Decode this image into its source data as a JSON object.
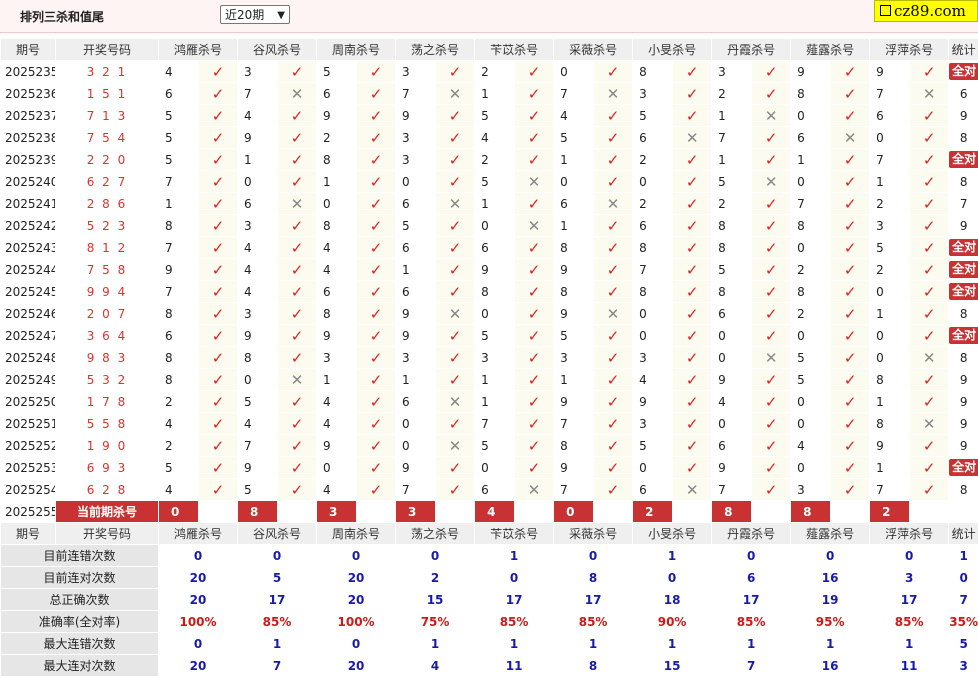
{
  "header": {
    "title": "排列三杀和值尾",
    "period_select": "近20期",
    "logo_text": "cz89.com"
  },
  "columns": {
    "period": "期号",
    "draw": "开奖号码",
    "experts": [
      "鸿雁杀号",
      "谷风杀号",
      "周南杀号",
      "荡之杀号",
      "苄苡杀号",
      "采薇杀号",
      "小旻杀号",
      "丹霞杀号",
      "薤露杀号",
      "浮萍杀号"
    ],
    "stat": "统计"
  },
  "rows": [
    {
      "period": "2025235",
      "draw": "321",
      "k": [
        4,
        3,
        5,
        3,
        2,
        0,
        8,
        3,
        9,
        9
      ],
      "r": [
        1,
        1,
        1,
        1,
        1,
        1,
        1,
        1,
        1,
        1
      ],
      "stat": "全对"
    },
    {
      "period": "2025236",
      "draw": "151",
      "k": [
        6,
        7,
        6,
        7,
        1,
        7,
        3,
        2,
        8,
        7
      ],
      "r": [
        1,
        0,
        1,
        0,
        1,
        0,
        1,
        1,
        1,
        0
      ],
      "stat": "6"
    },
    {
      "period": "2025237",
      "draw": "713",
      "k": [
        5,
        4,
        9,
        9,
        5,
        4,
        5,
        1,
        0,
        6
      ],
      "r": [
        1,
        1,
        1,
        1,
        1,
        1,
        1,
        0,
        1,
        1
      ],
      "stat": "9"
    },
    {
      "period": "2025238",
      "draw": "754",
      "k": [
        5,
        9,
        2,
        3,
        4,
        5,
        6,
        7,
        6,
        0
      ],
      "r": [
        1,
        1,
        1,
        1,
        1,
        1,
        0,
        1,
        0,
        1
      ],
      "stat": "8"
    },
    {
      "period": "2025239",
      "draw": "220",
      "k": [
        5,
        1,
        8,
        3,
        2,
        1,
        2,
        1,
        1,
        7
      ],
      "r": [
        1,
        1,
        1,
        1,
        1,
        1,
        1,
        1,
        1,
        1
      ],
      "stat": "全对"
    },
    {
      "period": "2025240",
      "draw": "627",
      "k": [
        7,
        0,
        1,
        0,
        5,
        0,
        0,
        5,
        0,
        1
      ],
      "r": [
        1,
        1,
        1,
        1,
        0,
        1,
        1,
        0,
        1,
        1
      ],
      "stat": "8"
    },
    {
      "period": "2025241",
      "draw": "286",
      "k": [
        1,
        6,
        0,
        6,
        1,
        6,
        2,
        2,
        7,
        2
      ],
      "r": [
        1,
        0,
        1,
        0,
        1,
        0,
        1,
        1,
        1,
        1
      ],
      "stat": "7"
    },
    {
      "period": "2025242",
      "draw": "523",
      "k": [
        8,
        3,
        8,
        5,
        0,
        1,
        6,
        8,
        8,
        3
      ],
      "r": [
        1,
        1,
        1,
        1,
        0,
        1,
        1,
        1,
        1,
        1
      ],
      "stat": "9"
    },
    {
      "period": "2025243",
      "draw": "812",
      "k": [
        7,
        4,
        4,
        6,
        6,
        8,
        8,
        8,
        0,
        5
      ],
      "r": [
        1,
        1,
        1,
        1,
        1,
        1,
        1,
        1,
        1,
        1
      ],
      "stat": "全对"
    },
    {
      "period": "2025244",
      "draw": "758",
      "k": [
        9,
        4,
        4,
        1,
        9,
        9,
        7,
        5,
        2,
        2
      ],
      "r": [
        1,
        1,
        1,
        1,
        1,
        1,
        1,
        1,
        1,
        1
      ],
      "stat": "全对"
    },
    {
      "period": "2025245",
      "draw": "994",
      "k": [
        7,
        4,
        6,
        6,
        8,
        8,
        8,
        8,
        8,
        0
      ],
      "r": [
        1,
        1,
        1,
        1,
        1,
        1,
        1,
        1,
        1,
        1
      ],
      "stat": "全对"
    },
    {
      "period": "2025246",
      "draw": "207",
      "k": [
        8,
        3,
        8,
        9,
        0,
        9,
        0,
        6,
        2,
        1
      ],
      "r": [
        1,
        1,
        1,
        0,
        1,
        0,
        1,
        1,
        1,
        1
      ],
      "stat": "8"
    },
    {
      "period": "2025247",
      "draw": "364",
      "k": [
        6,
        9,
        9,
        9,
        5,
        5,
        0,
        0,
        0,
        0
      ],
      "r": [
        1,
        1,
        1,
        1,
        1,
        1,
        1,
        1,
        1,
        1
      ],
      "stat": "全对"
    },
    {
      "period": "2025248",
      "draw": "983",
      "k": [
        8,
        8,
        3,
        3,
        3,
        3,
        3,
        0,
        5,
        0
      ],
      "r": [
        1,
        1,
        1,
        1,
        1,
        1,
        1,
        0,
        1,
        0
      ],
      "stat": "8"
    },
    {
      "period": "2025249",
      "draw": "532",
      "k": [
        8,
        0,
        1,
        1,
        1,
        1,
        4,
        9,
        5,
        8
      ],
      "r": [
        1,
        0,
        1,
        1,
        1,
        1,
        1,
        1,
        1,
        1
      ],
      "stat": "9"
    },
    {
      "period": "2025250",
      "draw": "178",
      "k": [
        2,
        5,
        4,
        6,
        1,
        9,
        9,
        4,
        0,
        1
      ],
      "r": [
        1,
        1,
        1,
        0,
        1,
        1,
        1,
        1,
        1,
        1
      ],
      "stat": "9"
    },
    {
      "period": "2025251",
      "draw": "558",
      "k": [
        4,
        4,
        4,
        0,
        7,
        7,
        3,
        0,
        0,
        8
      ],
      "r": [
        1,
        1,
        1,
        1,
        1,
        1,
        1,
        1,
        1,
        0
      ],
      "stat": "9"
    },
    {
      "period": "2025252",
      "draw": "190",
      "k": [
        2,
        7,
        9,
        0,
        5,
        8,
        5,
        6,
        4,
        9
      ],
      "r": [
        1,
        1,
        1,
        0,
        1,
        1,
        1,
        1,
        1,
        1
      ],
      "stat": "9"
    },
    {
      "period": "2025253",
      "draw": "693",
      "k": [
        5,
        9,
        0,
        9,
        0,
        9,
        0,
        9,
        0,
        1
      ],
      "r": [
        1,
        1,
        1,
        1,
        1,
        1,
        1,
        1,
        1,
        1
      ],
      "stat": "全对"
    },
    {
      "period": "2025254",
      "draw": "628",
      "k": [
        4,
        5,
        4,
        7,
        6,
        7,
        6,
        7,
        3,
        7
      ],
      "r": [
        1,
        1,
        1,
        1,
        0,
        1,
        0,
        1,
        1,
        1
      ],
      "stat": "8"
    }
  ],
  "current": {
    "period": "2025255",
    "label": "当前期杀号",
    "kills": [
      "0",
      "8",
      "3",
      "3",
      "4",
      "0",
      "2",
      "8",
      "8",
      "2"
    ]
  },
  "summary": {
    "header_period": "期号",
    "header_draw": "开奖号码",
    "rows": [
      {
        "label": "目前连错次数",
        "values": [
          "0",
          "0",
          "0",
          "0",
          "1",
          "0",
          "1",
          "0",
          "0",
          "0"
        ],
        "stat": "1",
        "pct": false
      },
      {
        "label": "目前连对次数",
        "values": [
          "20",
          "5",
          "20",
          "2",
          "0",
          "8",
          "0",
          "6",
          "16",
          "3"
        ],
        "stat": "0",
        "pct": false
      },
      {
        "label": "总正确次数",
        "values": [
          "20",
          "17",
          "20",
          "15",
          "17",
          "17",
          "18",
          "17",
          "19",
          "17"
        ],
        "stat": "7",
        "pct": false
      },
      {
        "label": "准确率(全对率)",
        "values": [
          "100%",
          "85%",
          "100%",
          "75%",
          "85%",
          "85%",
          "90%",
          "85%",
          "95%",
          "85%"
        ],
        "stat": "35%",
        "pct": true
      },
      {
        "label": "最大连错次数",
        "values": [
          "0",
          "1",
          "0",
          "1",
          "1",
          "1",
          "1",
          "1",
          "1",
          "1"
        ],
        "stat": "5",
        "pct": false
      },
      {
        "label": "最大连对次数",
        "values": [
          "20",
          "7",
          "20",
          "4",
          "11",
          "8",
          "15",
          "7",
          "16",
          "11"
        ],
        "stat": "3",
        "pct": false
      }
    ]
  }
}
